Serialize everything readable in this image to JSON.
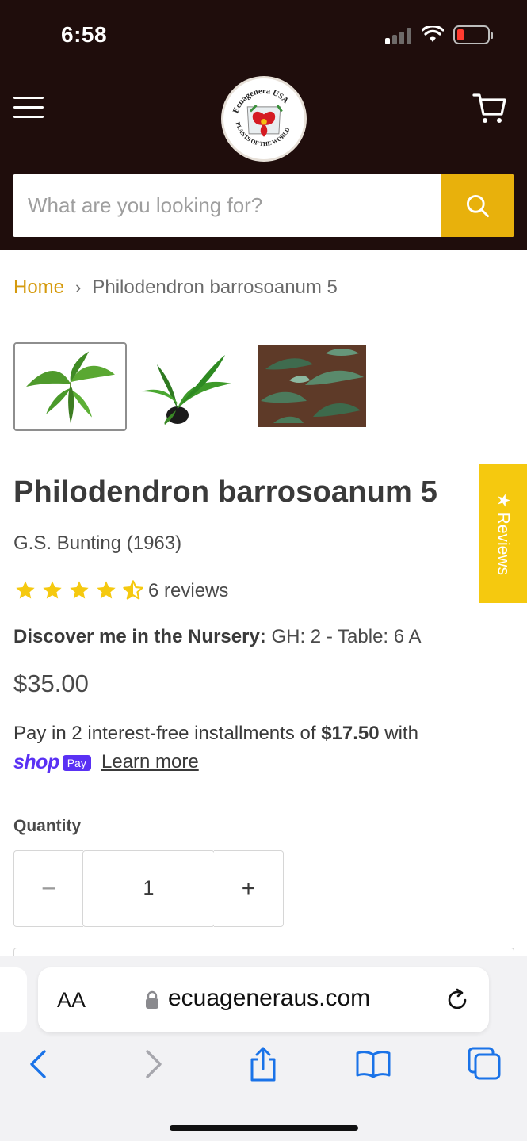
{
  "status_bar": {
    "time": "6:58",
    "icons": [
      "signal-icon",
      "wifi-icon",
      "battery-low-icon"
    ],
    "battery_color": "#ff3b30"
  },
  "header": {
    "background": "#1f0d0c",
    "menu_icon": "hamburger-icon",
    "logo": {
      "top_text": "Ecuagenera USA",
      "bottom_text": "PLANTS OF THE WORLD"
    },
    "cart_icon": "cart-icon"
  },
  "search": {
    "placeholder": "What are you looking for?",
    "button_icon": "search-icon",
    "accent": "#e8b10c"
  },
  "breadcrumb": {
    "home": "Home",
    "separator": "›",
    "current": "Philodendron barrosoanum 5"
  },
  "product": {
    "thumbnails": [
      "plant-photo-1",
      "plant-photo-2",
      "plant-photo-3"
    ],
    "title": "Philodendron barrosoanum 5",
    "author": "G.S. Bunting (1963)",
    "rating": 4.5,
    "rating_max": 5,
    "reviews_count": "6 reviews",
    "nursery_label": "Discover me in the Nursery:",
    "nursery_value": "GH: 2 - Table: 6 A",
    "price": "$35.00",
    "installments_pre": "Pay in 2 interest-free installments of",
    "installments_amount": "$17.50",
    "installments_post": "with",
    "shop_text": "shop",
    "pay_text": "Pay",
    "learn_more": "Learn more",
    "quantity_label": "Quantity",
    "quantity_value": "1",
    "minus": "−",
    "plus": "+",
    "star_color": "#f5c90f"
  },
  "reviews_tab": {
    "label": "★ Reviews",
    "color": "#f5c90f"
  },
  "browser": {
    "aa": "AA",
    "domain": "ecuageneraus.com",
    "icons": [
      "back-icon",
      "forward-icon",
      "share-icon",
      "bookmarks-icon",
      "tabs-icon"
    ],
    "accent": "#1a73e8"
  }
}
